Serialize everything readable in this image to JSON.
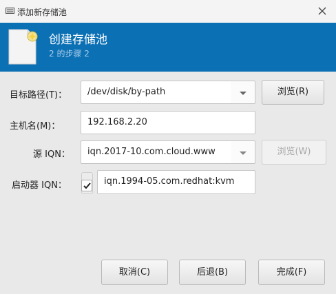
{
  "window": {
    "title": "添加新存储池",
    "app_icon": "storage-pool-icon",
    "close_icon": "close-icon"
  },
  "banner": {
    "heading": "创建存储池",
    "step": "2 的步骤 2",
    "icon": "document-add-icon",
    "background": "#0c70b4"
  },
  "form": {
    "target_path": {
      "label": "目标路径(T)：",
      "value": "/dev/disk/by-path",
      "browse_label": "浏览(R)"
    },
    "host_name": {
      "label": "主机名(M)：",
      "value": "192.168.2.20"
    },
    "source_iqn": {
      "label": "源 IQN：",
      "value": "iqn.2017-10.com.cloud.www",
      "browse_label": "浏览(W)"
    },
    "initiator_iqn": {
      "label": "启动器 IQN：",
      "checked": true,
      "value": "iqn.1994-05.com.redhat:kvm"
    }
  },
  "buttons": {
    "cancel": "取消(C)",
    "back": "后退(B)",
    "finish": "完成(F)"
  }
}
